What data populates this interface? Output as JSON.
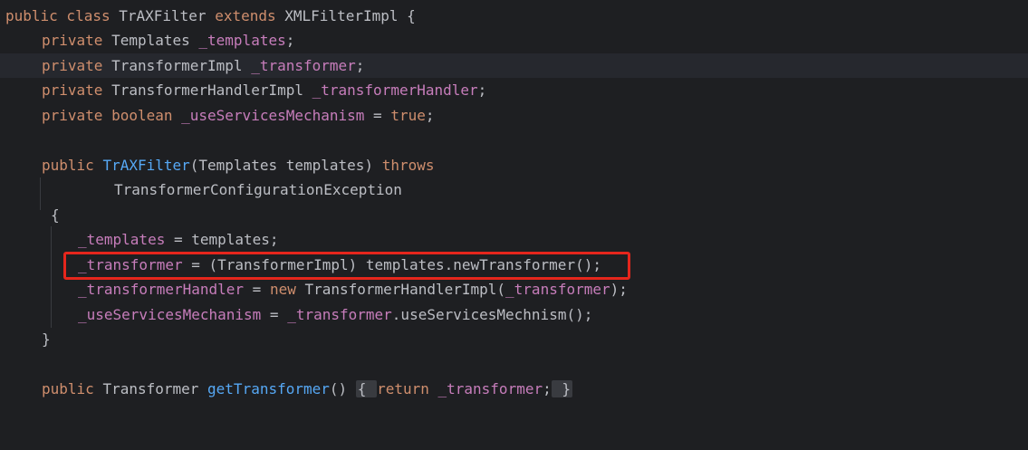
{
  "code": {
    "l1": {
      "kw1": "public class ",
      "name": "TrAXFilter ",
      "kw2": "extends ",
      "rest": "XMLFilterImpl {"
    },
    "l2": {
      "kw": "private ",
      "type": "Templates ",
      "field": "_templates",
      "end": ";"
    },
    "l3": {
      "kw": "private ",
      "type": "TransformerImpl ",
      "field": "_transformer",
      "end": ";"
    },
    "l4": {
      "kw": "private ",
      "type": "TransformerHandlerImpl ",
      "field": "_transformerHandler",
      "end": ";"
    },
    "l5": {
      "kw": "private ",
      "kw2": "boolean ",
      "field": "_useServicesMechanism",
      "eq": " = ",
      "val": "true",
      "end": ";"
    },
    "l6": {
      "kw": "public ",
      "ctor": "TrAXFilter",
      "params": "(Templates templates) ",
      "kw2": "throws"
    },
    "l7": {
      "text": "TransformerConfigurationException"
    },
    "l8": {
      "text": "{"
    },
    "l9": {
      "field": "_templates",
      "rest": " = templates;"
    },
    "l10": {
      "field": "_transformer",
      "rest": " = (TransformerImpl) templates.newTransformer();"
    },
    "l11": {
      "field": "_transformerHandler",
      "eq": " = ",
      "kw": "new ",
      "mid": "TransformerHandlerImpl(",
      "field2": "_transformer",
      "end": ");"
    },
    "l12": {
      "field": "_useServicesMechanism",
      "eq": " = ",
      "field2": "_transformer",
      "rest": ".useServicesMechnism();"
    },
    "l13": {
      "text": "}"
    },
    "l14": {
      "kw": "public ",
      "type": "Transformer ",
      "fn": "getTransformer",
      "paren": "() ",
      "open": "{ ",
      "kw2": "return ",
      "field": "_transformer",
      "semi": ";",
      "close": " }"
    }
  },
  "colors": {
    "background": "#1e1f22",
    "keyword": "#cf8e6d",
    "field": "#c77dbb",
    "function": "#56a8f5",
    "plain": "#bcbec4",
    "highlight_border": "#e5261c"
  }
}
